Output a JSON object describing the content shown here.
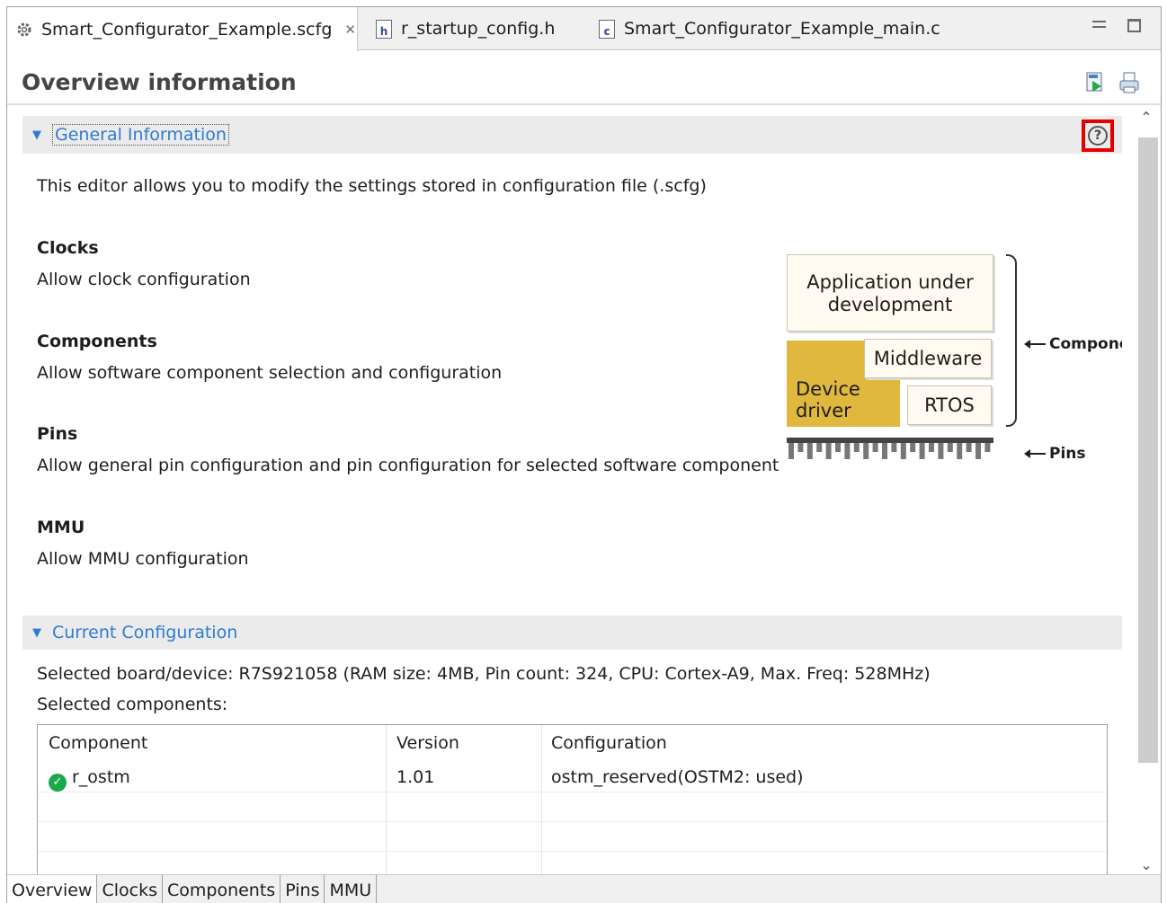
{
  "tabs": [
    {
      "label": "Smart_Configurator_Example.scfg",
      "icon": "gear-icon",
      "active": true,
      "closable": true
    },
    {
      "label": "r_startup_config.h",
      "icon": "header-file-icon",
      "badge": "h"
    },
    {
      "label": "Smart_Configurator_Example_main.c",
      "icon": "c-file-icon",
      "badge": "c"
    }
  ],
  "editor": {
    "title": "Overview information"
  },
  "general": {
    "title": "General Information",
    "description": "This editor allows you to modify the settings stored in configuration file (.scfg)",
    "items": [
      {
        "title": "Clocks",
        "desc": "Allow clock configuration"
      },
      {
        "title": "Components",
        "desc": "Allow software component selection and configuration"
      },
      {
        "title": "Pins",
        "desc": "Allow general pin configuration and pin configuration for selected software component"
      },
      {
        "title": "MMU",
        "desc": "Allow MMU configuration"
      }
    ]
  },
  "diagram": {
    "app": "Application under development",
    "app_line1": "Application under",
    "app_line2": "development",
    "middleware": "Middleware",
    "driver_line1": "Device",
    "driver_line2": "driver",
    "rtos": "RTOS",
    "components_label": "Compone",
    "pins_label": "Pins"
  },
  "current": {
    "title": "Current Configuration",
    "device_line": "Selected board/device:  R7S921058 (RAM size: 4MB, Pin count: 324, CPU: Cortex-A9, Max. Freq: 528MHz)",
    "components_label": "Selected components:",
    "columns": [
      "Component",
      "Version",
      "Configuration"
    ],
    "rows": [
      {
        "component": "r_ostm",
        "version": "1.01",
        "configuration": "ostm_reserved(OSTM2: used)",
        "status": "ok"
      }
    ]
  },
  "bottom_tabs": [
    "Overview",
    "Clocks",
    "Components",
    "Pins",
    "MMU"
  ],
  "colors": {
    "link_blue": "#2f7bd1",
    "highlight_red": "#e40000",
    "driver_yellow": "#dfb83d",
    "ok_green": "#19a84b"
  }
}
